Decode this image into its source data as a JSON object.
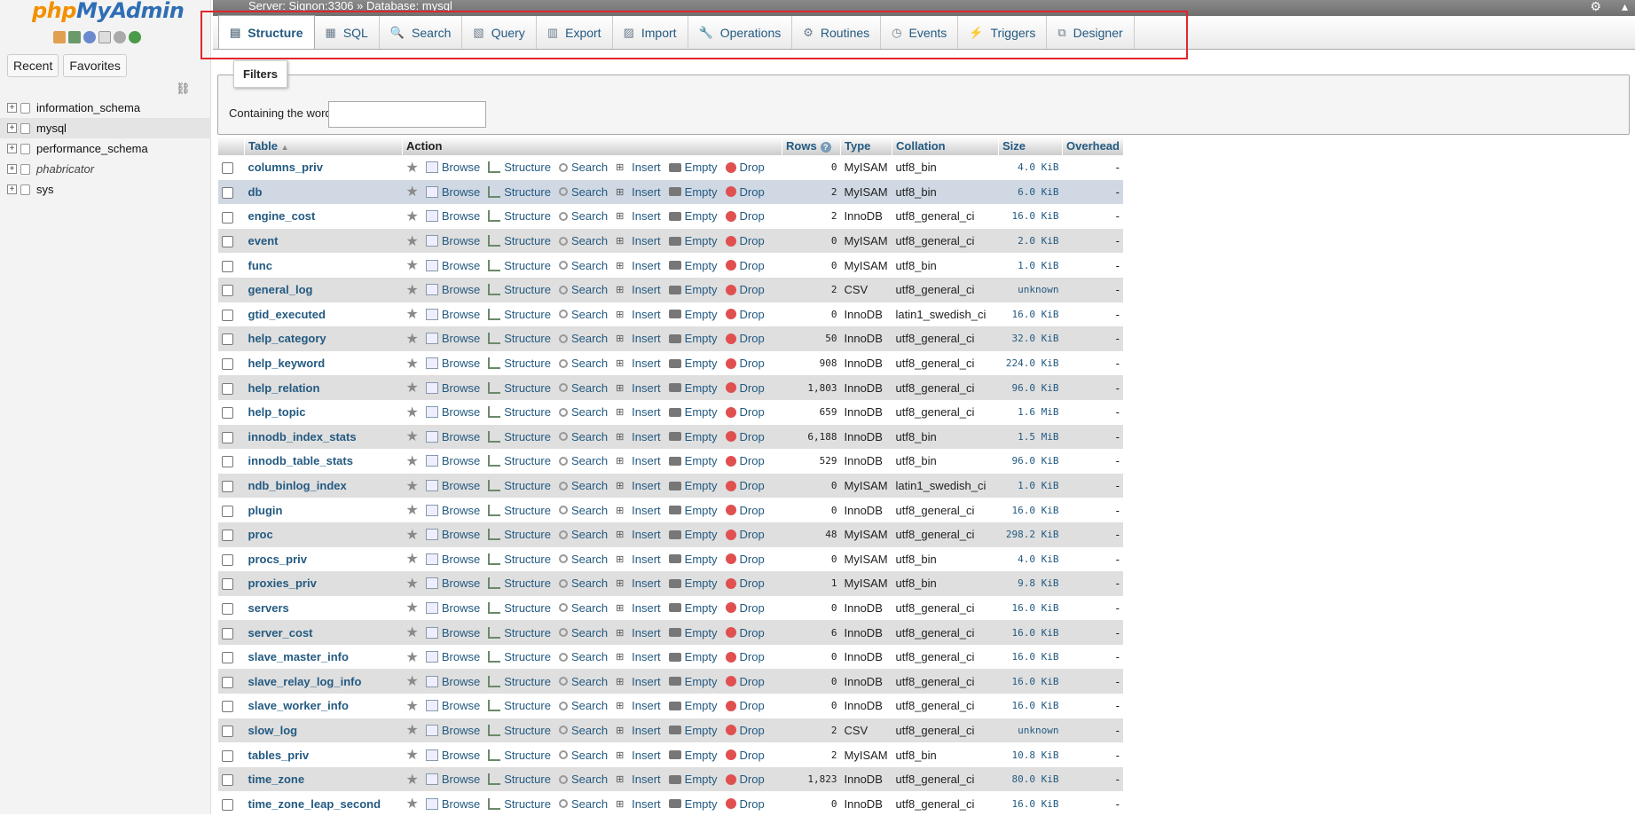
{
  "app": {
    "logo_php": "php",
    "logo_my": "MyAdmin"
  },
  "nav": {
    "tabs": [
      "Recent",
      "Favorites"
    ],
    "databases": [
      {
        "name": "information_schema",
        "selected": false,
        "italic": false
      },
      {
        "name": "mysql",
        "selected": true,
        "italic": false
      },
      {
        "name": "performance_schema",
        "selected": false,
        "italic": false
      },
      {
        "name": "phabricator",
        "selected": false,
        "italic": true
      },
      {
        "name": "sys",
        "selected": false,
        "italic": false
      }
    ]
  },
  "breadcrumb": {
    "server": "Server: Signon:3306",
    "sep": "»",
    "database": "Database: mysql"
  },
  "tabs": [
    {
      "label": "Structure",
      "icon": "structure-icon",
      "active": true
    },
    {
      "label": "SQL",
      "icon": "sql-icon",
      "active": false
    },
    {
      "label": "Search",
      "icon": "search-icon",
      "active": false
    },
    {
      "label": "Query",
      "icon": "query-icon",
      "active": false
    },
    {
      "label": "Export",
      "icon": "export-icon",
      "active": false
    },
    {
      "label": "Import",
      "icon": "import-icon",
      "active": false
    },
    {
      "label": "Operations",
      "icon": "wrench-icon",
      "active": false
    },
    {
      "label": "Routines",
      "icon": "routines-icon",
      "active": false
    },
    {
      "label": "Events",
      "icon": "clock-icon",
      "active": false
    },
    {
      "label": "Triggers",
      "icon": "triggers-icon",
      "active": false
    },
    {
      "label": "Designer",
      "icon": "designer-icon",
      "active": false
    }
  ],
  "filters": {
    "legend": "Filters",
    "label": "Containing the word:",
    "value": ""
  },
  "table": {
    "headers": {
      "table": "Table",
      "action": "Action",
      "rows": "Rows",
      "type": "Type",
      "collation": "Collation",
      "size": "Size",
      "overhead": "Overhead"
    },
    "actions": [
      "Browse",
      "Structure",
      "Search",
      "Insert",
      "Empty",
      "Drop"
    ],
    "rows": [
      {
        "name": "columns_priv",
        "rows": "0",
        "type": "MyISAM",
        "collation": "utf8_bin",
        "size": "4.0 KiB",
        "overhead": "-"
      },
      {
        "name": "db",
        "rows": "2",
        "type": "MyISAM",
        "collation": "utf8_bin",
        "size": "6.0 KiB",
        "overhead": "-"
      },
      {
        "name": "engine_cost",
        "rows": "2",
        "type": "InnoDB",
        "collation": "utf8_general_ci",
        "size": "16.0 KiB",
        "overhead": "-"
      },
      {
        "name": "event",
        "rows": "0",
        "type": "MyISAM",
        "collation": "utf8_general_ci",
        "size": "2.0 KiB",
        "overhead": "-"
      },
      {
        "name": "func",
        "rows": "0",
        "type": "MyISAM",
        "collation": "utf8_bin",
        "size": "1.0 KiB",
        "overhead": "-"
      },
      {
        "name": "general_log",
        "rows": "2",
        "type": "CSV",
        "collation": "utf8_general_ci",
        "size": "unknown",
        "overhead": "-"
      },
      {
        "name": "gtid_executed",
        "rows": "0",
        "type": "InnoDB",
        "collation": "latin1_swedish_ci",
        "size": "16.0 KiB",
        "overhead": "-"
      },
      {
        "name": "help_category",
        "rows": "50",
        "type": "InnoDB",
        "collation": "utf8_general_ci",
        "size": "32.0 KiB",
        "overhead": "-"
      },
      {
        "name": "help_keyword",
        "rows": "908",
        "type": "InnoDB",
        "collation": "utf8_general_ci",
        "size": "224.0 KiB",
        "overhead": "-"
      },
      {
        "name": "help_relation",
        "rows": "1,803",
        "type": "InnoDB",
        "collation": "utf8_general_ci",
        "size": "96.0 KiB",
        "overhead": "-"
      },
      {
        "name": "help_topic",
        "rows": "659",
        "type": "InnoDB",
        "collation": "utf8_general_ci",
        "size": "1.6 MiB",
        "overhead": "-"
      },
      {
        "name": "innodb_index_stats",
        "rows": "6,188",
        "type": "InnoDB",
        "collation": "utf8_bin",
        "size": "1.5 MiB",
        "overhead": "-"
      },
      {
        "name": "innodb_table_stats",
        "rows": "529",
        "type": "InnoDB",
        "collation": "utf8_bin",
        "size": "96.0 KiB",
        "overhead": "-"
      },
      {
        "name": "ndb_binlog_index",
        "rows": "0",
        "type": "MyISAM",
        "collation": "latin1_swedish_ci",
        "size": "1.0 KiB",
        "overhead": "-"
      },
      {
        "name": "plugin",
        "rows": "0",
        "type": "InnoDB",
        "collation": "utf8_general_ci",
        "size": "16.0 KiB",
        "overhead": "-"
      },
      {
        "name": "proc",
        "rows": "48",
        "type": "MyISAM",
        "collation": "utf8_general_ci",
        "size": "298.2 KiB",
        "overhead": "-"
      },
      {
        "name": "procs_priv",
        "rows": "0",
        "type": "MyISAM",
        "collation": "utf8_bin",
        "size": "4.0 KiB",
        "overhead": "-"
      },
      {
        "name": "proxies_priv",
        "rows": "1",
        "type": "MyISAM",
        "collation": "utf8_bin",
        "size": "9.8 KiB",
        "overhead": "-"
      },
      {
        "name": "servers",
        "rows": "0",
        "type": "InnoDB",
        "collation": "utf8_general_ci",
        "size": "16.0 KiB",
        "overhead": "-"
      },
      {
        "name": "server_cost",
        "rows": "6",
        "type": "InnoDB",
        "collation": "utf8_general_ci",
        "size": "16.0 KiB",
        "overhead": "-"
      },
      {
        "name": "slave_master_info",
        "rows": "0",
        "type": "InnoDB",
        "collation": "utf8_general_ci",
        "size": "16.0 KiB",
        "overhead": "-"
      },
      {
        "name": "slave_relay_log_info",
        "rows": "0",
        "type": "InnoDB",
        "collation": "utf8_general_ci",
        "size": "16.0 KiB",
        "overhead": "-"
      },
      {
        "name": "slave_worker_info",
        "rows": "0",
        "type": "InnoDB",
        "collation": "utf8_general_ci",
        "size": "16.0 KiB",
        "overhead": "-"
      },
      {
        "name": "slow_log",
        "rows": "2",
        "type": "CSV",
        "collation": "utf8_general_ci",
        "size": "unknown",
        "overhead": "-"
      },
      {
        "name": "tables_priv",
        "rows": "2",
        "type": "MyISAM",
        "collation": "utf8_bin",
        "size": "10.8 KiB",
        "overhead": "-"
      },
      {
        "name": "time_zone",
        "rows": "1,823",
        "type": "InnoDB",
        "collation": "utf8_general_ci",
        "size": "80.0 KiB",
        "overhead": "-"
      },
      {
        "name": "time_zone_leap_second",
        "rows": "0",
        "type": "InnoDB",
        "collation": "utf8_general_ci",
        "size": "16.0 KiB",
        "overhead": "-"
      }
    ]
  }
}
